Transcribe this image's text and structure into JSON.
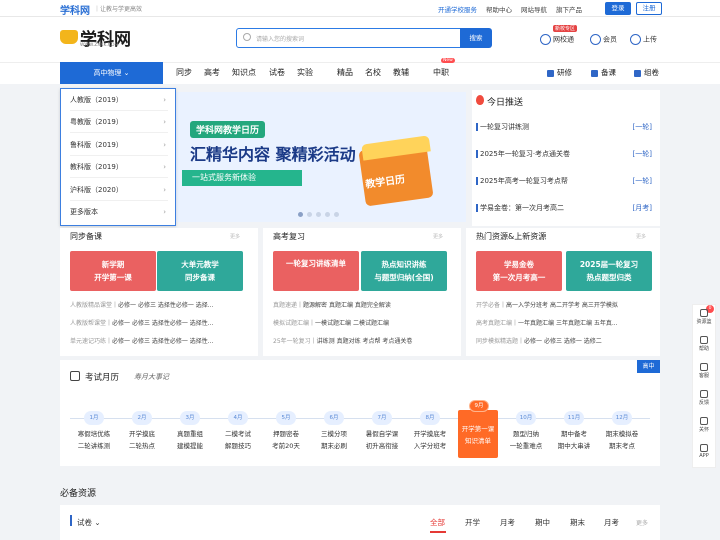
{
  "topbar": {
    "logo": "学科网",
    "slogan": "让教与学更高效",
    "links": [
      "开通学校服务",
      "帮助中心",
      "网站导航",
      "旗下产品"
    ],
    "login": "登录",
    "register": "注册"
  },
  "header": {
    "logo_text": "学科网",
    "logo_url": "WWW.ZXXK.COM",
    "search_placeholder": "请输入您的搜索词",
    "search_button": "搜索",
    "school_badge": "新校专区",
    "icons": [
      "网校通",
      "会员",
      "上传"
    ]
  },
  "nav": {
    "subject": "高中物理",
    "items": [
      "同步",
      "高考",
      "知识点",
      "试卷",
      "实验",
      "精品",
      "名校",
      "教辅",
      "中职"
    ],
    "new_badge": "New",
    "right": [
      "研修",
      "备课",
      "组卷"
    ]
  },
  "dropdown": [
    "人教版（2019）",
    "粤教版（2019）",
    "鲁科版（2019）",
    "教科版（2019）",
    "沪科版（2020）",
    "更多版本"
  ],
  "banner": {
    "tag": "学科网教学日历",
    "main": "汇精华内容 聚精彩活动",
    "sub": "一站式服务新体验",
    "calendar": "教学日历"
  },
  "today": {
    "title": "今日推送",
    "items": [
      {
        "text": "一轮复习讲练测",
        "tag": "[一轮]"
      },
      {
        "text": "2025年一轮复习·考点通关卷",
        "tag": "[一轮]"
      },
      {
        "text": "2025年高考一轮复习考点帮",
        "tag": "[一轮]"
      },
      {
        "text": "学易金卷：第一次月考高二",
        "tag": "[月考]"
      }
    ]
  },
  "cols": [
    {
      "title": "同步备课",
      "more": "更多",
      "cards": [
        [
          "新学期",
          "开学第一课"
        ],
        [
          "大单元教学",
          "同步备课"
        ]
      ],
      "rows": [
        [
          "人教版精品课堂",
          "必修一 必修三 选择性必修一 选择..."
        ],
        [
          "人教版帮课堂",
          "必修一 必修三 选择性必修一 选择性..."
        ],
        [
          "单元速记巧练",
          "必修一 必修三 选择性必修一 选择性..."
        ]
      ]
    },
    {
      "title": "高考复习",
      "more": "更多",
      "cards": [
        [
          "一轮复习讲练清单",
          ""
        ],
        [
          "热点知识讲练",
          "与题型归纳(全国)"
        ]
      ],
      "rows": [
        [
          "真题速递",
          "题源解密 真题汇编 真题完全解读"
        ],
        [
          "模拟试题汇编",
          "一模试题汇编 二模试题汇编"
        ],
        [
          "25年一轮复习",
          "讲练测 真题对练 考点帮 考点通关卷"
        ]
      ]
    },
    {
      "title": "热门资源&上新资源",
      "more": "更多",
      "cards": [
        [
          "学易金卷",
          "第一次月考高一"
        ],
        [
          "2025届一轮复习",
          "热点题型归类"
        ]
      ],
      "rows": [
        [
          "开学必备",
          "高一入学分班考 高二开学考 高三开学模拟"
        ],
        [
          "高考真题汇编",
          "一年真题汇编 三年真题汇编 五年真..."
        ],
        [
          "同步模拟精选题",
          "必修一 必修三 选修一 选修二"
        ]
      ]
    }
  ],
  "calendar": {
    "title": "考试月历",
    "hand": "寿月大事记",
    "badge": "高中",
    "months": [
      {
        "m": "1月",
        "t": [
          "寒假培优练",
          "二轮讲练测"
        ]
      },
      {
        "m": "2月",
        "t": [
          "开学摸底",
          "二轮热点"
        ]
      },
      {
        "m": "3月",
        "t": [
          "真题重组",
          "建模提能"
        ]
      },
      {
        "m": "4月",
        "t": [
          "二模考试",
          "解题技巧"
        ]
      },
      {
        "m": "5月",
        "t": [
          "押题密卷",
          "考前20天"
        ]
      },
      {
        "m": "6月",
        "t": [
          "三模分项",
          "期末必刷"
        ]
      },
      {
        "m": "7月",
        "t": [
          "暑假自学课",
          "初升高衔接"
        ]
      },
      {
        "m": "8月",
        "t": [
          "开学摸底考",
          "入学分班考"
        ]
      },
      {
        "m": "10月",
        "t": [
          "题型归纳",
          "一轮重难点"
        ]
      },
      {
        "m": "11月",
        "t": [
          "期中备考",
          "期中大串讲"
        ]
      },
      {
        "m": "12月",
        "t": [
          "期末模拟卷",
          "期末考点"
        ]
      }
    ],
    "highlight": {
      "m": "9月",
      "t": [
        "开学第一课",
        "知识清单"
      ]
    }
  },
  "bottom": {
    "section": "必备资源",
    "filter": "试卷",
    "tabs": [
      "全部",
      "开学",
      "月考",
      "期中",
      "期末",
      "月考"
    ],
    "more": "更多"
  },
  "rail": [
    "资源篮",
    "帮助",
    "客服",
    "反馈",
    "关怀",
    "APP"
  ],
  "rail_badge": "0"
}
